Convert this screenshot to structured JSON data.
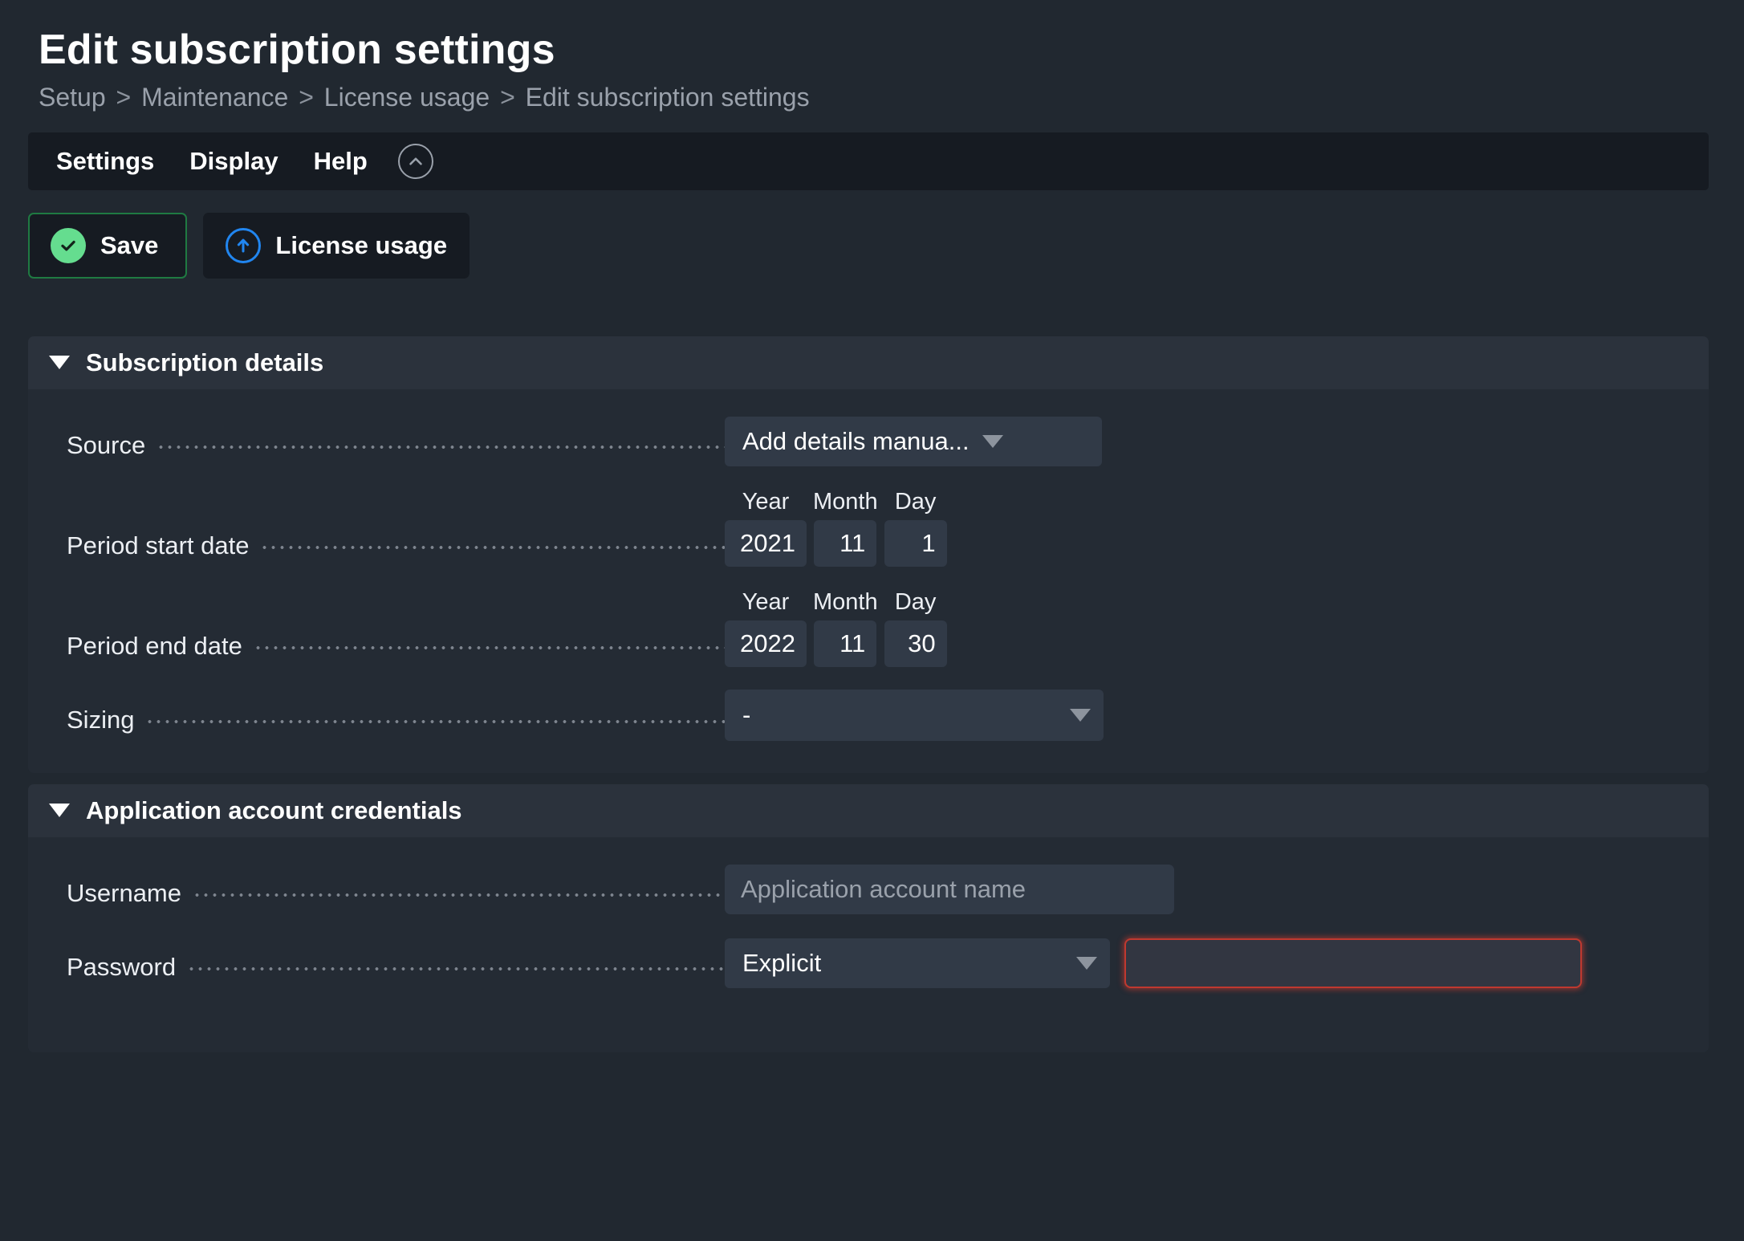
{
  "header": {
    "title": "Edit subscription settings",
    "breadcrumb": {
      "items": [
        "Setup",
        "Maintenance",
        "License usage",
        "Edit subscription settings"
      ],
      "separator": ">"
    }
  },
  "menubar": {
    "items": [
      "Settings",
      "Display",
      "Help"
    ],
    "collapse_icon": "chevron-up-icon"
  },
  "toolbar": {
    "save_label": "Save",
    "save_icon": "check-circle-icon",
    "license_usage_label": "License usage",
    "license_usage_icon": "arrow-up-circle-icon"
  },
  "sections": {
    "subscription": {
      "title": "Subscription details",
      "caret_icon": "caret-down-icon",
      "source": {
        "label": "Source",
        "value": "Add details manua...",
        "arrow_icon": "chevron-down-icon"
      },
      "period_start": {
        "label": "Period start date",
        "year_label": "Year",
        "month_label": "Month",
        "day_label": "Day",
        "year": "2021",
        "month": "11",
        "day": "1"
      },
      "period_end": {
        "label": "Period end date",
        "year_label": "Year",
        "month_label": "Month",
        "day_label": "Day",
        "year": "2022",
        "month": "11",
        "day": "30"
      },
      "sizing": {
        "label": "Sizing",
        "value": "-",
        "arrow_icon": "chevron-down-icon"
      }
    },
    "credentials": {
      "title": "Application account credentials",
      "caret_icon": "caret-down-icon",
      "username": {
        "label": "Username",
        "value": "",
        "placeholder": "Application account name"
      },
      "password": {
        "label": "Password",
        "type_value": "Explicit",
        "value": "",
        "placeholder": "",
        "arrow_icon": "chevron-down-icon",
        "error": true
      }
    }
  },
  "colors": {
    "page_background": "#212830",
    "panel_background": "#242b34",
    "panel_header": "#2b323c",
    "menubar_background": "#161b22",
    "input_background": "#313a47",
    "save_accent": "#65dd8f",
    "save_border": "#1f7a42",
    "license_accent": "#2186f0",
    "error_border": "#c0392f",
    "text_primary": "#ffffff",
    "text_muted": "#9aa1ab"
  }
}
